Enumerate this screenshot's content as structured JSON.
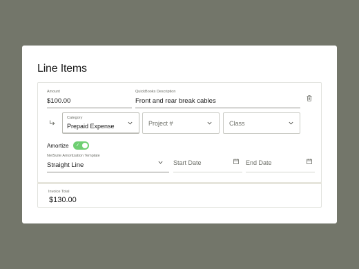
{
  "card": {
    "title": "Line Items"
  },
  "line_item": {
    "amount": {
      "label": "Amount",
      "value": "$100.00"
    },
    "description": {
      "label": "QuickBooks Description",
      "value": "Front and rear break cables"
    },
    "category": {
      "label": "Category",
      "value": "Prepaid Expense"
    },
    "project": {
      "placeholder": "Project #"
    },
    "class": {
      "placeholder": "Class"
    },
    "amortize": {
      "label": "Amortize",
      "enabled": true
    },
    "template": {
      "label": "NetSuite Amortization Template",
      "value": "Straight Line"
    },
    "start_date": {
      "placeholder": "Start Date"
    },
    "end_date": {
      "placeholder": "End Date"
    }
  },
  "invoice_total": {
    "label": "Invoice Total",
    "value": "$130.00"
  },
  "colors": {
    "background": "#73766a",
    "toggle_on": "#6fcf72"
  },
  "icons": [
    "trash-icon",
    "sub-item-arrow-icon",
    "chevron-down-icon",
    "calendar-icon",
    "check-icon"
  ]
}
